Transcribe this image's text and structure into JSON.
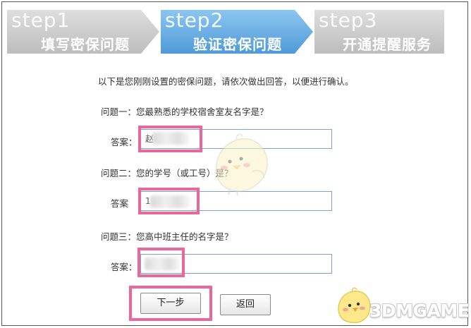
{
  "steps": [
    {
      "en": "step1",
      "cn": "填写密保问题"
    },
    {
      "en": "step2",
      "cn": "验证密保问题"
    },
    {
      "en": "step3",
      "cn": "开通提醒服务"
    }
  ],
  "intro": "以下是您刚刚设置的密保问题，请依次做出回答，以便进行确认。",
  "questions": [
    {
      "question": "问题一：您最熟悉的学校宿舍室友名字是？",
      "answer_label": "答案：",
      "answer_value": "赵"
    },
    {
      "question": "问题二：您的学号（或工号）是？",
      "answer_label": "答案",
      "answer_value": "1"
    },
    {
      "question": "问题三：您高中班主任的名字是？",
      "answer_label": "答案：",
      "answer_value": ""
    }
  ],
  "buttons": {
    "next": "下一步",
    "back": "返回"
  },
  "watermark": "3DMGAME",
  "colors": {
    "step_inactive": "#cfcfcf",
    "step_active": "#6fb2e6",
    "highlight": "#e9679a",
    "input_border": "#7da2ce"
  }
}
